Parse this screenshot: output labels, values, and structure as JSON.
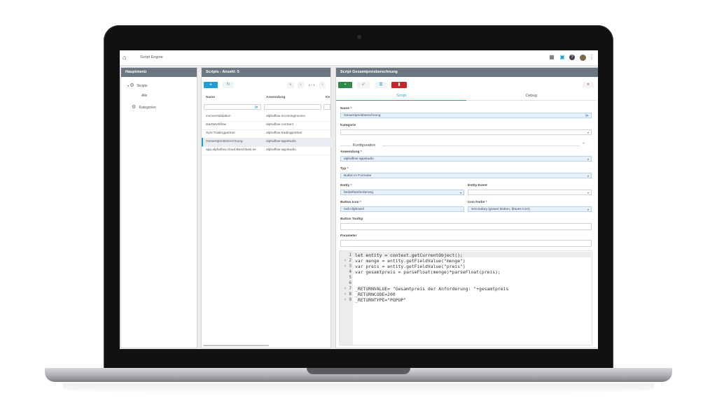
{
  "header": {
    "title": "Script Engine"
  },
  "main_menu": {
    "title": "Hauptmenü",
    "items": [
      {
        "label": "Skripts",
        "children": [
          "Alle"
        ]
      },
      {
        "label": "Kategorien"
      }
    ]
  },
  "scripts_panel": {
    "title": "Scripts - Anzahl: 5",
    "add_label": "+",
    "refresh_label": "↻",
    "pager": {
      "first": "«",
      "prev": "‹",
      "page": "1 / 1",
      "next": "›"
    },
    "columns": [
      "Name",
      "Anwendung",
      "Ke"
    ],
    "rows": [
      {
        "name": "invoiceValidation",
        "app": "alphaflow-incominginvoice"
      },
      {
        "name": "startWorkflow",
        "app": "alphaflow-contract"
      },
      {
        "name": "SyncTradingpartner",
        "app": "alphaflow-tradingpartner"
      },
      {
        "name": "Gesamtpreisberechnung",
        "app": "alphaflow-appstudio"
      },
      {
        "name": "app.alphaflow.cloud.Beschluss.se",
        "app": "alphaflow-appstudio"
      }
    ]
  },
  "script_panel": {
    "title": "Script Gesamtpreisberechnung",
    "tabs": [
      "Script",
      "Debug"
    ],
    "close_label": "✕",
    "labels": {
      "name": "Name",
      "kategorie": "Kategorie",
      "konfiguration": "Konfiguration",
      "anwendung": "Anwendung",
      "typ": "Typ",
      "entity": "Entity",
      "entity_event": "Entity Event",
      "button_icon": "Button Icon",
      "icon_farbe": "Icon Farbe",
      "button_tooltip": "Button Tooltip",
      "parameter": "Parameter"
    },
    "values": {
      "name": "Gesamtpreisberechnung",
      "kategorie": "",
      "anwendung": "alphaflow-appstudio",
      "typ": "Button in Formular",
      "entity": "bedarfsanforderung",
      "entity_event": "",
      "button_icon": "mdi-clipboard",
      "icon_farbe": "Secondary (grauer Button, blaues Icon)",
      "button_tooltip": "",
      "parameter": ""
    },
    "required_mark": "*"
  },
  "code": {
    "line_numbers": [
      "1",
      "2",
      "3",
      "4",
      "5",
      "6",
      "7",
      "8",
      "9"
    ],
    "fold_marks": [
      "",
      "‹",
      "‹",
      "",
      "",
      "",
      "‹",
      "‹",
      "‹"
    ],
    "lines": [
      "let entity = context.getCurrentObject();",
      "var menge = entity.getFieldValue(\"menge\")",
      "var preis = entity.getFieldValue(\"preis\")",
      "var gesamtpreis = parseFloat(menge)*parseFloat(preis);",
      "",
      "",
      "_RETURNVALUE= \"Gesamtpreis der Anforderung: \"+gesamtpreis",
      "_RETURNCODE=200",
      "_RETURNTYPE=\"POPUP\""
    ]
  },
  "colors": {
    "panel_header": "#6b7682",
    "accent_blue": "#1e9ed8",
    "save_green": "#2e8b4a",
    "delete_red": "#c62828"
  }
}
